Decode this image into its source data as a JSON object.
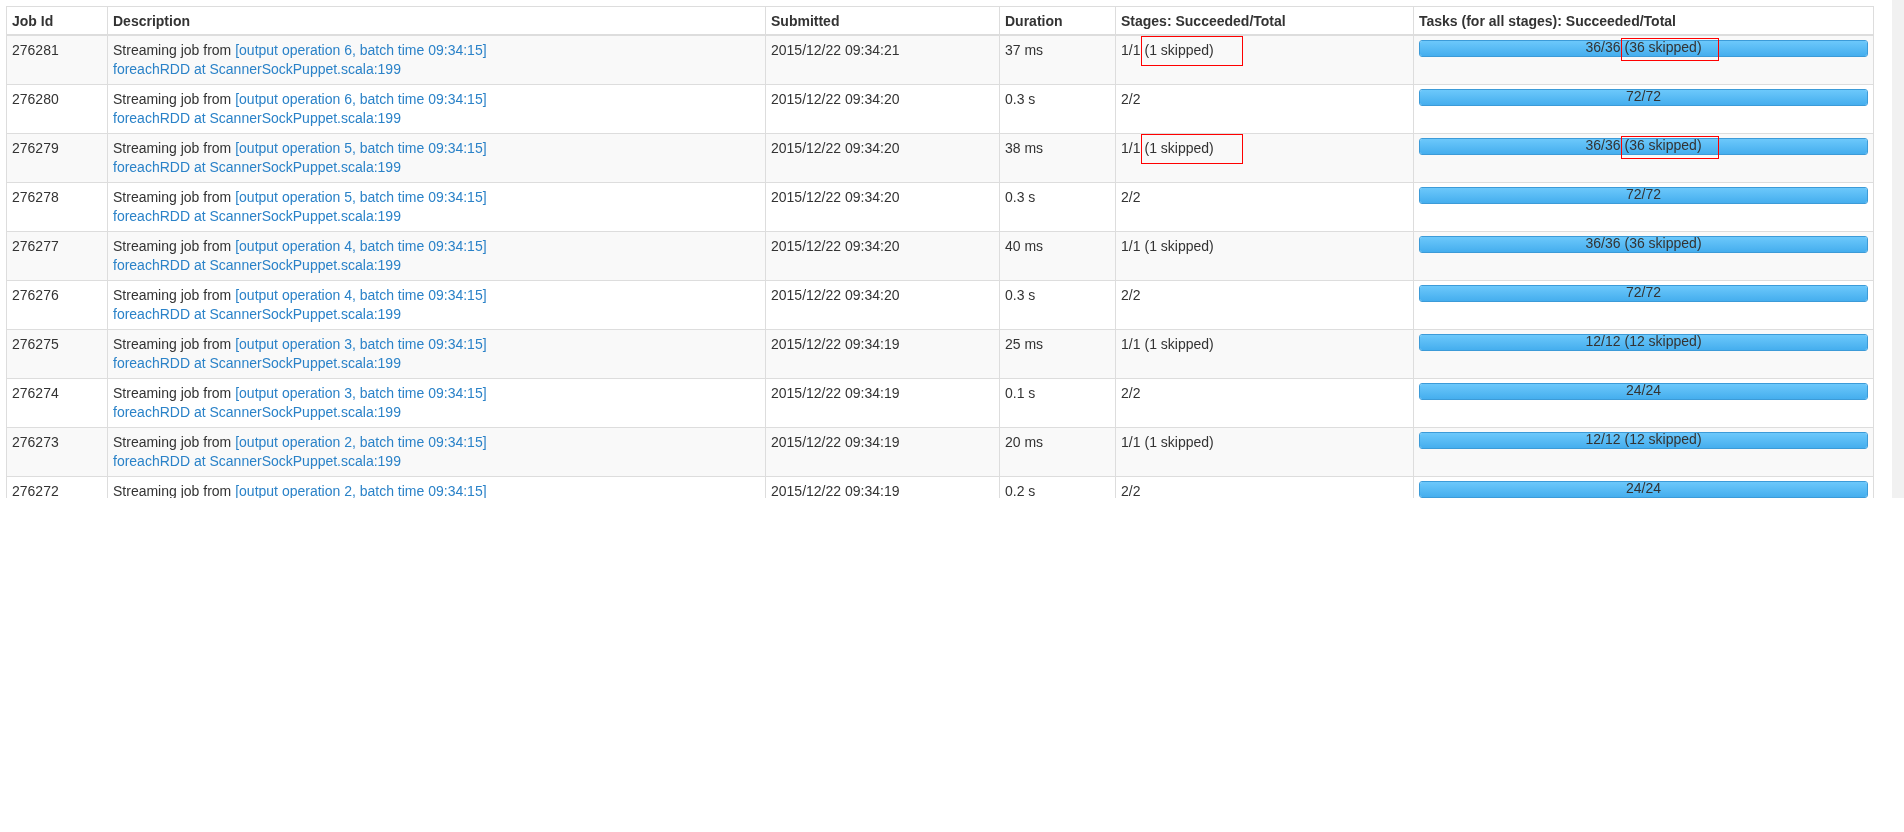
{
  "table": {
    "columns": [
      "Job Id",
      "Description",
      "Submitted",
      "Duration",
      "Stages: Succeeded/Total",
      "Tasks (for all stages): Succeeded/Total"
    ],
    "rows": [
      {
        "job_id": "276281",
        "description": {
          "prefix": "Streaming job from",
          "link": "[output operation 6, batch time 09:34:15]",
          "detail": "foreachRDD at ScannerSockPuppet.scala:199"
        },
        "submitted": "2015/12/22 09:34:21",
        "duration": "37 ms",
        "stages": {
          "count": "1/1",
          "skipped": "(1 skipped)",
          "highlighted": true
        },
        "tasks": {
          "count": "36/36",
          "skipped": "(36 skipped)",
          "highlighted": true,
          "level": 1
        }
      },
      {
        "job_id": "276280",
        "description": {
          "prefix": "Streaming job from",
          "link": "[output operation 6, batch time 09:34:15]",
          "detail": "foreachRDD at ScannerSockPuppet.scala:199"
        },
        "submitted": "2015/12/22 09:34:20",
        "duration": "0.3 s",
        "stages": {
          "count": "2/2"
        },
        "tasks": {
          "count": "72/72",
          "level": 1
        }
      },
      {
        "job_id": "276279",
        "description": {
          "prefix": "Streaming job from",
          "link": "[output operation 5, batch time 09:34:15]",
          "detail": "foreachRDD at ScannerSockPuppet.scala:199"
        },
        "submitted": "2015/12/22 09:34:20",
        "duration": "38 ms",
        "stages": {
          "count": "1/1",
          "skipped": "(1 skipped)",
          "highlighted": true
        },
        "tasks": {
          "count": "36/36",
          "skipped": "(36 skipped)",
          "highlighted": true,
          "level": 1
        }
      },
      {
        "job_id": "276278",
        "description": {
          "prefix": "Streaming job from",
          "link": "[output operation 5, batch time 09:34:15]",
          "detail": "foreachRDD at ScannerSockPuppet.scala:199"
        },
        "submitted": "2015/12/22 09:34:20",
        "duration": "0.3 s",
        "stages": {
          "count": "2/2"
        },
        "tasks": {
          "count": "72/72",
          "level": 1
        }
      },
      {
        "job_id": "276277",
        "description": {
          "prefix": "Streaming job from",
          "link": "[output operation 4, batch time 09:34:15]",
          "detail": "foreachRDD at ScannerSockPuppet.scala:199"
        },
        "submitted": "2015/12/22 09:34:20",
        "duration": "40 ms",
        "stages": {
          "count": "1/1",
          "skipped": "(1 skipped)"
        },
        "tasks": {
          "count": "36/36",
          "skipped": "(36 skipped)",
          "level": 1
        }
      },
      {
        "job_id": "276276",
        "description": {
          "prefix": "Streaming job from",
          "link": "[output operation 4, batch time 09:34:15]",
          "detail": "foreachRDD at ScannerSockPuppet.scala:199"
        },
        "submitted": "2015/12/22 09:34:20",
        "duration": "0.3 s",
        "stages": {
          "count": "2/2"
        },
        "tasks": {
          "count": "72/72",
          "level": 1
        }
      },
      {
        "job_id": "276275",
        "description": {
          "prefix": "Streaming job from",
          "link": "[output operation 3, batch time 09:34:15]",
          "detail": "foreachRDD at ScannerSockPuppet.scala:199"
        },
        "submitted": "2015/12/22 09:34:19",
        "duration": "25 ms",
        "stages": {
          "count": "1/1",
          "skipped": "(1 skipped)"
        },
        "tasks": {
          "count": "12/12",
          "skipped": "(12 skipped)",
          "level": 1
        }
      },
      {
        "job_id": "276274",
        "description": {
          "prefix": "Streaming job from",
          "link": "[output operation 3, batch time 09:34:15]",
          "detail": "foreachRDD at ScannerSockPuppet.scala:199"
        },
        "submitted": "2015/12/22 09:34:19",
        "duration": "0.1 s",
        "stages": {
          "count": "2/2"
        },
        "tasks": {
          "count": "24/24",
          "level": 1
        }
      },
      {
        "job_id": "276273",
        "description": {
          "prefix": "Streaming job from",
          "link": "[output operation 2, batch time 09:34:15]",
          "detail": "foreachRDD at ScannerSockPuppet.scala:199"
        },
        "submitted": "2015/12/22 09:34:19",
        "duration": "20 ms",
        "stages": {
          "count": "1/1",
          "skipped": "(1 skipped)"
        },
        "tasks": {
          "count": "12/12",
          "skipped": "(12 skipped)",
          "level": 1
        }
      },
      {
        "job_id": "276272",
        "description": {
          "prefix": "Streaming job from",
          "link": "[output operation 2, batch time 09:34:15]"
        },
        "submitted": "2015/12/22 09:34:19",
        "duration": "0.2 s",
        "stages": {
          "count": "2/2"
        },
        "tasks": {
          "count": "24/24",
          "level": 1
        }
      }
    ]
  }
}
